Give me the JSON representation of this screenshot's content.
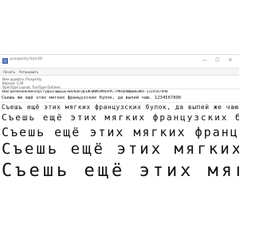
{
  "window": {
    "title": "prosperity-font.ttf",
    "buttons": [
      "—",
      "☐",
      "✕"
    ]
  },
  "toolbar": {
    "print_label": "Печать",
    "install_label": "Установить"
  },
  "info": {
    "font_name": "Имя шрифта: Prosperity",
    "version": "Версия: 1.00",
    "license": "OpenType Layout, TrueType Outlines"
  },
  "samples": [
    {
      "text": "абвгдеёжзийклмнопрстуфхцчшщъыьэюяАБВГДЕЁЖЗИЙКЛМНОПРСТУФХЦЧШЩЪЫЬЭЮЯ 1234567890",
      "size": 4.5
    },
    {
      "text": "Съешь же ещё этих мягких французских булок, да выпей чаю. 1234567890",
      "size": 5.5
    },
    {
      "text": "Съешь ещё этих мягких французских булок, да выпей же чаю.",
      "size": 8
    },
    {
      "text": "Съешь ещё этих мягких французских булок",
      "size": 11
    },
    {
      "text": "Съешь ещё этих мягких франц",
      "size": 15
    },
    {
      "text": "Съешь ещё этих мягких",
      "size": 19
    },
    {
      "text": "Съешь ещё этих мяг",
      "size": 22
    }
  ],
  "colors": {
    "accent": "#3a6ec2",
    "text": "#111111"
  }
}
